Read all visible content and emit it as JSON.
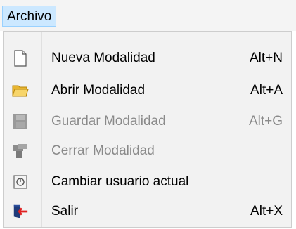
{
  "menubar": {
    "title": "Archivo"
  },
  "menu": {
    "items": [
      {
        "label": "Nueva Modalidad",
        "shortcut": "Alt+N",
        "icon": "new-document-icon",
        "enabled": true
      },
      {
        "label": "Abrir Modalidad",
        "shortcut": "Alt+A",
        "icon": "folder-open-icon",
        "enabled": true
      },
      {
        "label": "Guardar Modalidad",
        "shortcut": "Alt+G",
        "icon": "save-icon",
        "enabled": false
      },
      {
        "label": "Cerrar Modalidad",
        "shortcut": "",
        "icon": "close-modality-icon",
        "enabled": false
      },
      {
        "label": "Cambiar usuario actual",
        "shortcut": "",
        "icon": "change-user-icon",
        "enabled": true
      },
      {
        "label": "Salir",
        "shortcut": "Alt+X",
        "icon": "exit-icon",
        "enabled": true
      }
    ]
  },
  "colors": {
    "menubar_highlight": "#cce8ff",
    "menu_background": "#f2f2f2",
    "disabled_text": "#8a8a8a",
    "exit_arrow": "#e02020"
  }
}
